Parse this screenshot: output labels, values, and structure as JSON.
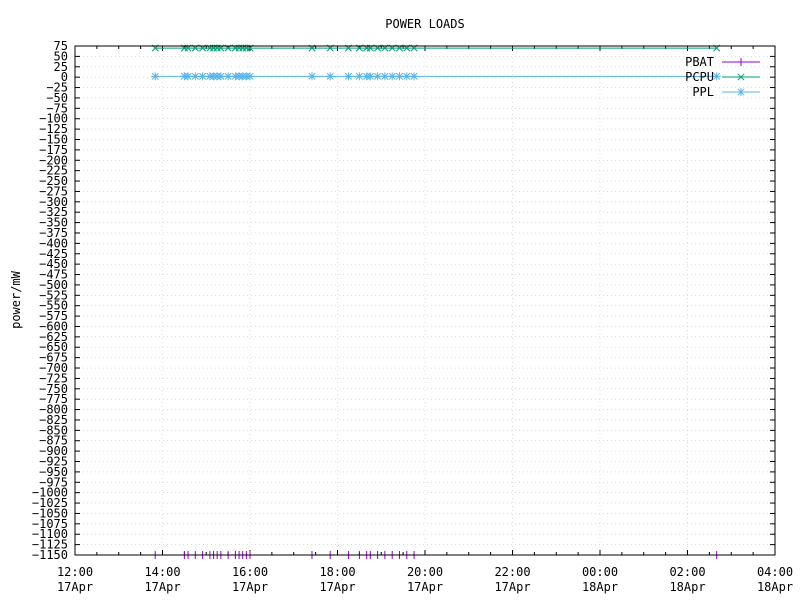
{
  "chart_data": {
    "type": "line",
    "title": "POWER LOADS",
    "ylabel": "power/mW",
    "xlabel": "",
    "ylim": [
      -1150,
      75
    ],
    "yticks": [
      75,
      50,
      25,
      0,
      -25,
      -50,
      -75,
      -100,
      -125,
      -150,
      -175,
      -200,
      -225,
      -250,
      -275,
      -300,
      -325,
      -350,
      -375,
      -400,
      -425,
      -450,
      -475,
      -500,
      -525,
      -550,
      -575,
      -600,
      -625,
      -650,
      -675,
      -700,
      -725,
      -750,
      -775,
      -800,
      -825,
      -850,
      -875,
      -900,
      -925,
      -950,
      -975,
      -1000,
      -1025,
      -1050,
      -1075,
      -1100,
      -1125,
      -1150
    ],
    "ytick_labels": [
      "75",
      "50",
      "25",
      "0",
      "−25",
      "−50",
      "−75",
      "−100",
      "−125",
      "−150",
      "−175",
      "−200",
      "−225",
      "−250",
      "−275",
      "−300",
      "−325",
      "−350",
      "−375",
      "−400",
      "−425",
      "−450",
      "−475",
      "−500",
      "−525",
      "−550",
      "−575",
      "−600",
      "−625",
      "−650",
      "−675",
      "−700",
      "−725",
      "−750",
      "−775",
      "−800",
      "−825",
      "−850",
      "−875",
      "−900",
      "−925",
      "−950",
      "−975",
      "−1000",
      "−1025",
      "−1050",
      "−1075",
      "−1100",
      "−1125",
      "−1150"
    ],
    "xlim": [
      "12:00",
      "04:00"
    ],
    "xticks": [
      {
        "time": "12:00",
        "date": "17Apr"
      },
      {
        "time": "14:00",
        "date": "17Apr"
      },
      {
        "time": "16:00",
        "date": "17Apr"
      },
      {
        "time": "18:00",
        "date": "17Apr"
      },
      {
        "time": "20:00",
        "date": "17Apr"
      },
      {
        "time": "22:00",
        "date": "17Apr"
      },
      {
        "time": "00:00",
        "date": "18Apr"
      },
      {
        "time": "02:00",
        "date": "18Apr"
      },
      {
        "time": "04:00",
        "date": "18Apr"
      }
    ],
    "grid": true,
    "legend_position": "top-right",
    "series": [
      {
        "name": "PBAT",
        "color": "#9400d3",
        "marker": "plus",
        "x": [
          "13:50",
          "14:30",
          "14:35",
          "14:45",
          "14:55",
          "15:05",
          "15:10",
          "15:15",
          "15:20",
          "15:30",
          "15:40",
          "15:45",
          "15:50",
          "15:55",
          "16:00",
          "17:25",
          "17:50",
          "18:15",
          "18:30",
          "18:40",
          "18:45",
          "18:55",
          "19:05",
          "19:15",
          "19:25",
          "19:35",
          "19:45",
          "02:40"
        ],
        "y": [
          -1150,
          -1150,
          -1150,
          -1150,
          -1150,
          -1150,
          -1150,
          -1150,
          -1150,
          -1150,
          -1150,
          -1150,
          -1150,
          -1150,
          -1150,
          -1150,
          -1150,
          -1150,
          -1150,
          -1150,
          -1150,
          -1150,
          -1150,
          -1150,
          -1150,
          -1150,
          -1150,
          -1150
        ]
      },
      {
        "name": "PCPU",
        "color": "#009e73",
        "marker": "cross",
        "x": [
          "13:50",
          "14:30",
          "14:35",
          "14:45",
          "14:55",
          "15:05",
          "15:10",
          "15:15",
          "15:20",
          "15:30",
          "15:40",
          "15:45",
          "15:50",
          "15:55",
          "16:00",
          "17:25",
          "17:50",
          "18:15",
          "18:30",
          "18:40",
          "18:45",
          "18:55",
          "19:05",
          "19:15",
          "19:25",
          "19:35",
          "19:45",
          "02:40"
        ],
        "y": [
          70,
          70,
          70,
          70,
          70,
          70,
          70,
          70,
          70,
          70,
          70,
          70,
          70,
          70,
          70,
          70,
          70,
          70,
          70,
          70,
          70,
          70,
          70,
          70,
          70,
          70,
          70,
          70
        ]
      },
      {
        "name": "PPL",
        "color": "#56b4e9",
        "marker": "star",
        "x": [
          "13:50",
          "14:30",
          "14:35",
          "14:45",
          "14:55",
          "15:05",
          "15:10",
          "15:15",
          "15:20",
          "15:30",
          "15:40",
          "15:45",
          "15:50",
          "15:55",
          "16:00",
          "17:25",
          "17:50",
          "18:15",
          "18:30",
          "18:40",
          "18:45",
          "18:55",
          "19:05",
          "19:15",
          "19:25",
          "19:35",
          "19:45",
          "02:40"
        ],
        "y": [
          2,
          2,
          2,
          2,
          2,
          2,
          2,
          2,
          2,
          2,
          2,
          2,
          2,
          2,
          2,
          2,
          2,
          2,
          2,
          2,
          2,
          2,
          2,
          2,
          2,
          2,
          2,
          2
        ]
      }
    ]
  }
}
